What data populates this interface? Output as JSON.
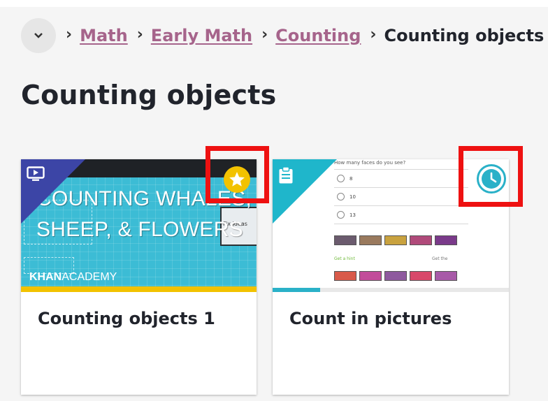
{
  "breadcrumb": {
    "items": [
      "Math",
      "Early Math",
      "Counting"
    ],
    "current": "Counting objects",
    "separator": "›"
  },
  "page": {
    "title": "Counting objects"
  },
  "cards": [
    {
      "type": "video",
      "title": "Counting objects 1",
      "thumbnail_text": [
        "COUNTING WHALES,",
        "SHEEP, & FLOWERS"
      ],
      "brand_bold": "KHAN",
      "brand_light": "ACADEMY",
      "status_icon": "star-icon",
      "status_color": "#f2c200"
    },
    {
      "type": "exercise",
      "title": "Count in pictures",
      "question_text": "How many faces do you see?",
      "options": [
        "8",
        "10",
        "13"
      ],
      "hint_text": "Get a hint",
      "hint_text_2": "Get the",
      "progress": 0.2,
      "status_icon": "clock-icon",
      "status_color": "#2ab1c8"
    }
  ],
  "colors": {
    "link": "#a6648b",
    "video_corner": "#3c45a6",
    "exercise_corner": "#1fb6cb",
    "highlight": "#ee1111"
  }
}
